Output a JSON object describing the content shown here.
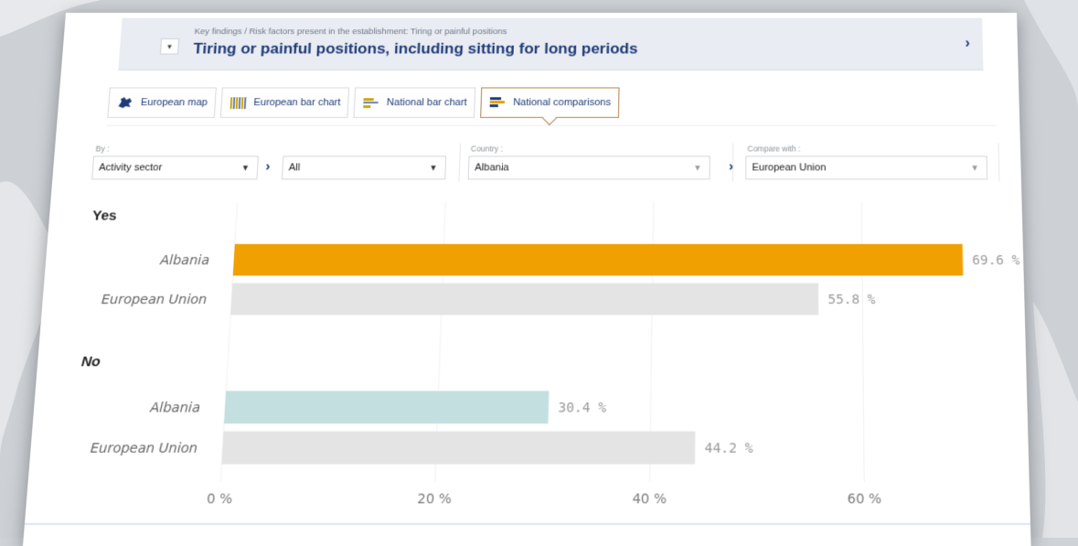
{
  "header": {
    "collapse_icon": "chevron-down-icon",
    "breadcrumb": "Key findings  / Risk factors present in the establishment: Tiring or painful positions",
    "title": "Tiring or painful positions, including sitting for long periods",
    "next_icon": "chevron-right-icon"
  },
  "tabs": [
    {
      "label": "European map",
      "icon": "europe-map-icon",
      "active": false
    },
    {
      "label": "European bar chart",
      "icon": "bar-chart-icon",
      "active": false
    },
    {
      "label": "National bar chart",
      "icon": "horizontal-bar-icon",
      "active": false
    },
    {
      "label": "National comparisons",
      "icon": "comparison-icon",
      "active": true
    }
  ],
  "filters": {
    "by_label": "By :",
    "by_value": "Activity sector",
    "sub_value": "All",
    "country_label": "Country :",
    "country_value": "Albania",
    "compare_label": "Compare with :",
    "compare_value": "European Union"
  },
  "colors": {
    "title": "#1f3a78",
    "yes_country_bar": "#f0a000",
    "no_country_bar": "#c3dfe0",
    "eu_bar": "#e4e4e4"
  },
  "chart_data": {
    "type": "bar",
    "orientation": "horizontal",
    "groups": [
      {
        "name": "Yes",
        "bars": [
          {
            "label": "Albania",
            "value": 69.6,
            "value_label": "69.6 %"
          },
          {
            "label": "European Union",
            "value": 55.8,
            "value_label": "55.8 %"
          }
        ]
      },
      {
        "name": "No",
        "bars": [
          {
            "label": "Albania",
            "value": 30.4,
            "value_label": "30.4 %"
          },
          {
            "label": "European Union",
            "value": 44.2,
            "value_label": "44.2 %"
          }
        ]
      }
    ],
    "xlim": [
      0,
      70
    ],
    "xticks": [
      0,
      20,
      40,
      60
    ],
    "xtick_labels": [
      "0 %",
      "20 %",
      "40 %",
      "60 %"
    ],
    "grid": true
  }
}
